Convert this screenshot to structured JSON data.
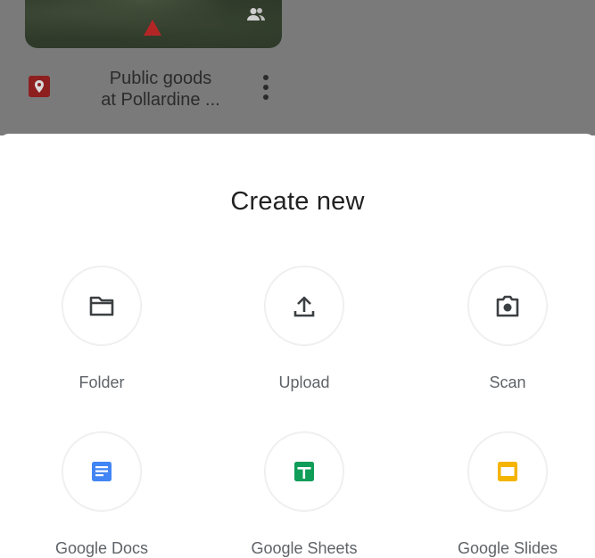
{
  "background": {
    "file_item": {
      "title": "Public goods at Pollardine ...",
      "title_line1": "Public goods",
      "title_line2": "at Pollardine ...",
      "icon": "map-pin-icon",
      "icon_color": "#b32626"
    }
  },
  "sheet": {
    "title": "Create new",
    "options": [
      {
        "label": "Folder",
        "icon": "folder-icon"
      },
      {
        "label": "Upload",
        "icon": "upload-icon"
      },
      {
        "label": "Scan",
        "icon": "camera-icon"
      },
      {
        "label": "Google Docs",
        "icon": "docs-icon",
        "color": "#4285f4"
      },
      {
        "label": "Google Sheets",
        "icon": "sheets-icon",
        "color": "#0f9d58"
      },
      {
        "label": "Google Slides",
        "icon": "slides-icon",
        "color": "#f4b400"
      }
    ]
  }
}
